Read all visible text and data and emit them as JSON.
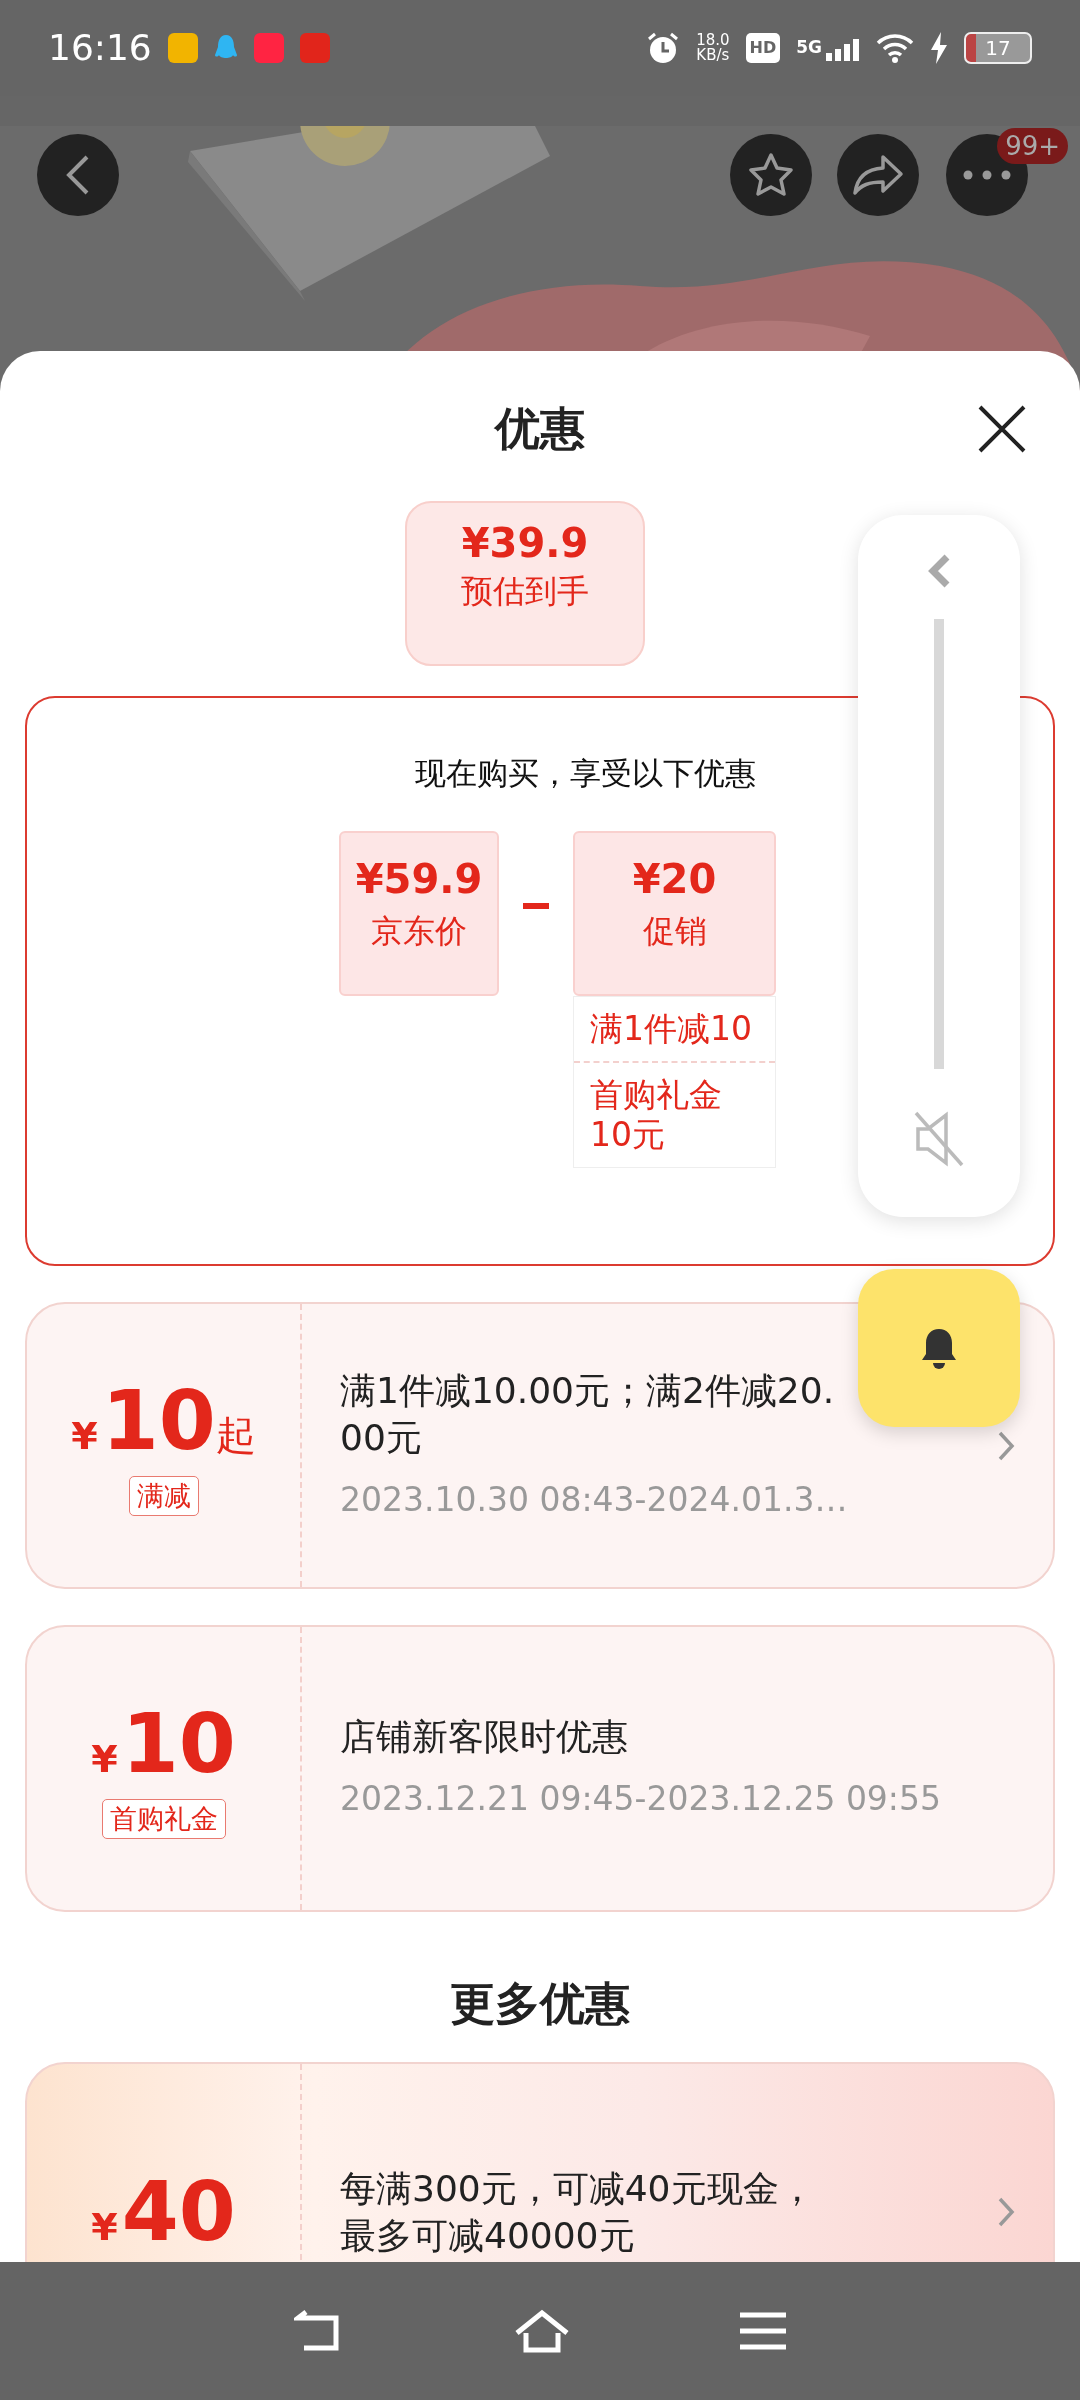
{
  "status_bar": {
    "time": "16:16",
    "net_speed": "18.0",
    "net_unit": "KB/s",
    "hd": "HD",
    "network": "5G",
    "battery": "17"
  },
  "header": {
    "badge": "99+"
  },
  "sheet": {
    "title": "优惠"
  },
  "estimate": {
    "price": "¥39.9",
    "label": "预估到手"
  },
  "breakdown": {
    "heading": "现在购买，享受以下优惠",
    "base": {
      "price": "¥59.9",
      "label": "京东价"
    },
    "discount": {
      "price": "¥20",
      "label": "促销"
    },
    "items": [
      "满1件减10",
      "首购礼金10元"
    ]
  },
  "coupons": [
    {
      "currency": "¥",
      "amount": "10",
      "suffix": "起",
      "tag": "满减",
      "title": "满1件减10.00元；满2件减20.00元",
      "period": "2023.10.30 08:43-2024.01.3…",
      "arrow": true
    },
    {
      "currency": "¥",
      "amount": "10",
      "tag": "首购礼金",
      "title": "店铺新客限时优惠",
      "period": "2023.12.21 09:45-2023.12.25 09:55",
      "arrow": false
    }
  ],
  "more": {
    "heading": "更多优惠",
    "coupons": [
      {
        "currency": "¥",
        "amount": "40",
        "title": "每满300元，可减40元现金，最多可减40000元",
        "arrow": true
      }
    ]
  },
  "volume": {
    "muted": true
  }
}
